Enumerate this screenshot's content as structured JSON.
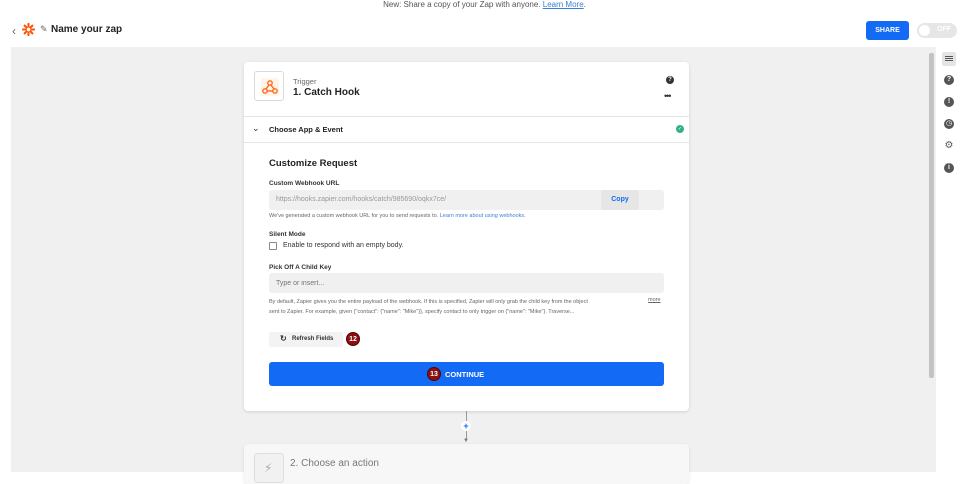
{
  "banner": {
    "text": "New: Share a copy of your Zap with anyone.",
    "link": "Learn More",
    "trailing": "."
  },
  "header": {
    "back": "‹",
    "pencil": "✎",
    "zap_name": "Name your zap",
    "share": "SHARE",
    "toggle": "OFF"
  },
  "step1": {
    "kind": "Trigger",
    "title": "1. Catch Hook",
    "help": "?",
    "more": "•••",
    "section": "Choose App & Event",
    "customize_title": "Customize Request",
    "webhook_label": "Custom Webhook URL",
    "webhook_url": "https://hooks.zapier.com/hooks/catch/985690/oqkx7ce/",
    "copy": "Copy",
    "webhook_help": "We've generated a custom webhook URL for you to send requests to.",
    "webhook_help_link": "Learn more about using webhooks",
    "webhook_help_end": ".",
    "silent_label": "Silent Mode",
    "silent_option": "Enable to respond with an empty body.",
    "child_key_label": "Pick Off A Child Key",
    "child_key_placeholder": "Type or insert...",
    "child_key_desc_1": "By default, Zapier gives you the entire payload of the webhook. If this is specified, Zapier will only grab the child key from the object",
    "child_key_desc_2": "sent to Zapier. For example, given {\"contact\": {\"name\": \"Mike\"}}, specify contact to only trigger on {\"name\": \"Mike\"}. Traverse...",
    "more_link": "more",
    "refresh": "Refresh Fields",
    "refresh_badge": "12",
    "continue": "CONTINUE",
    "continue_badge": "13"
  },
  "step2": {
    "title": "2. Choose an action"
  },
  "rightbar_icons": [
    "list-icon",
    "help-icon",
    "alert-icon",
    "clock-icon",
    "gear-icon",
    "info-icon"
  ]
}
